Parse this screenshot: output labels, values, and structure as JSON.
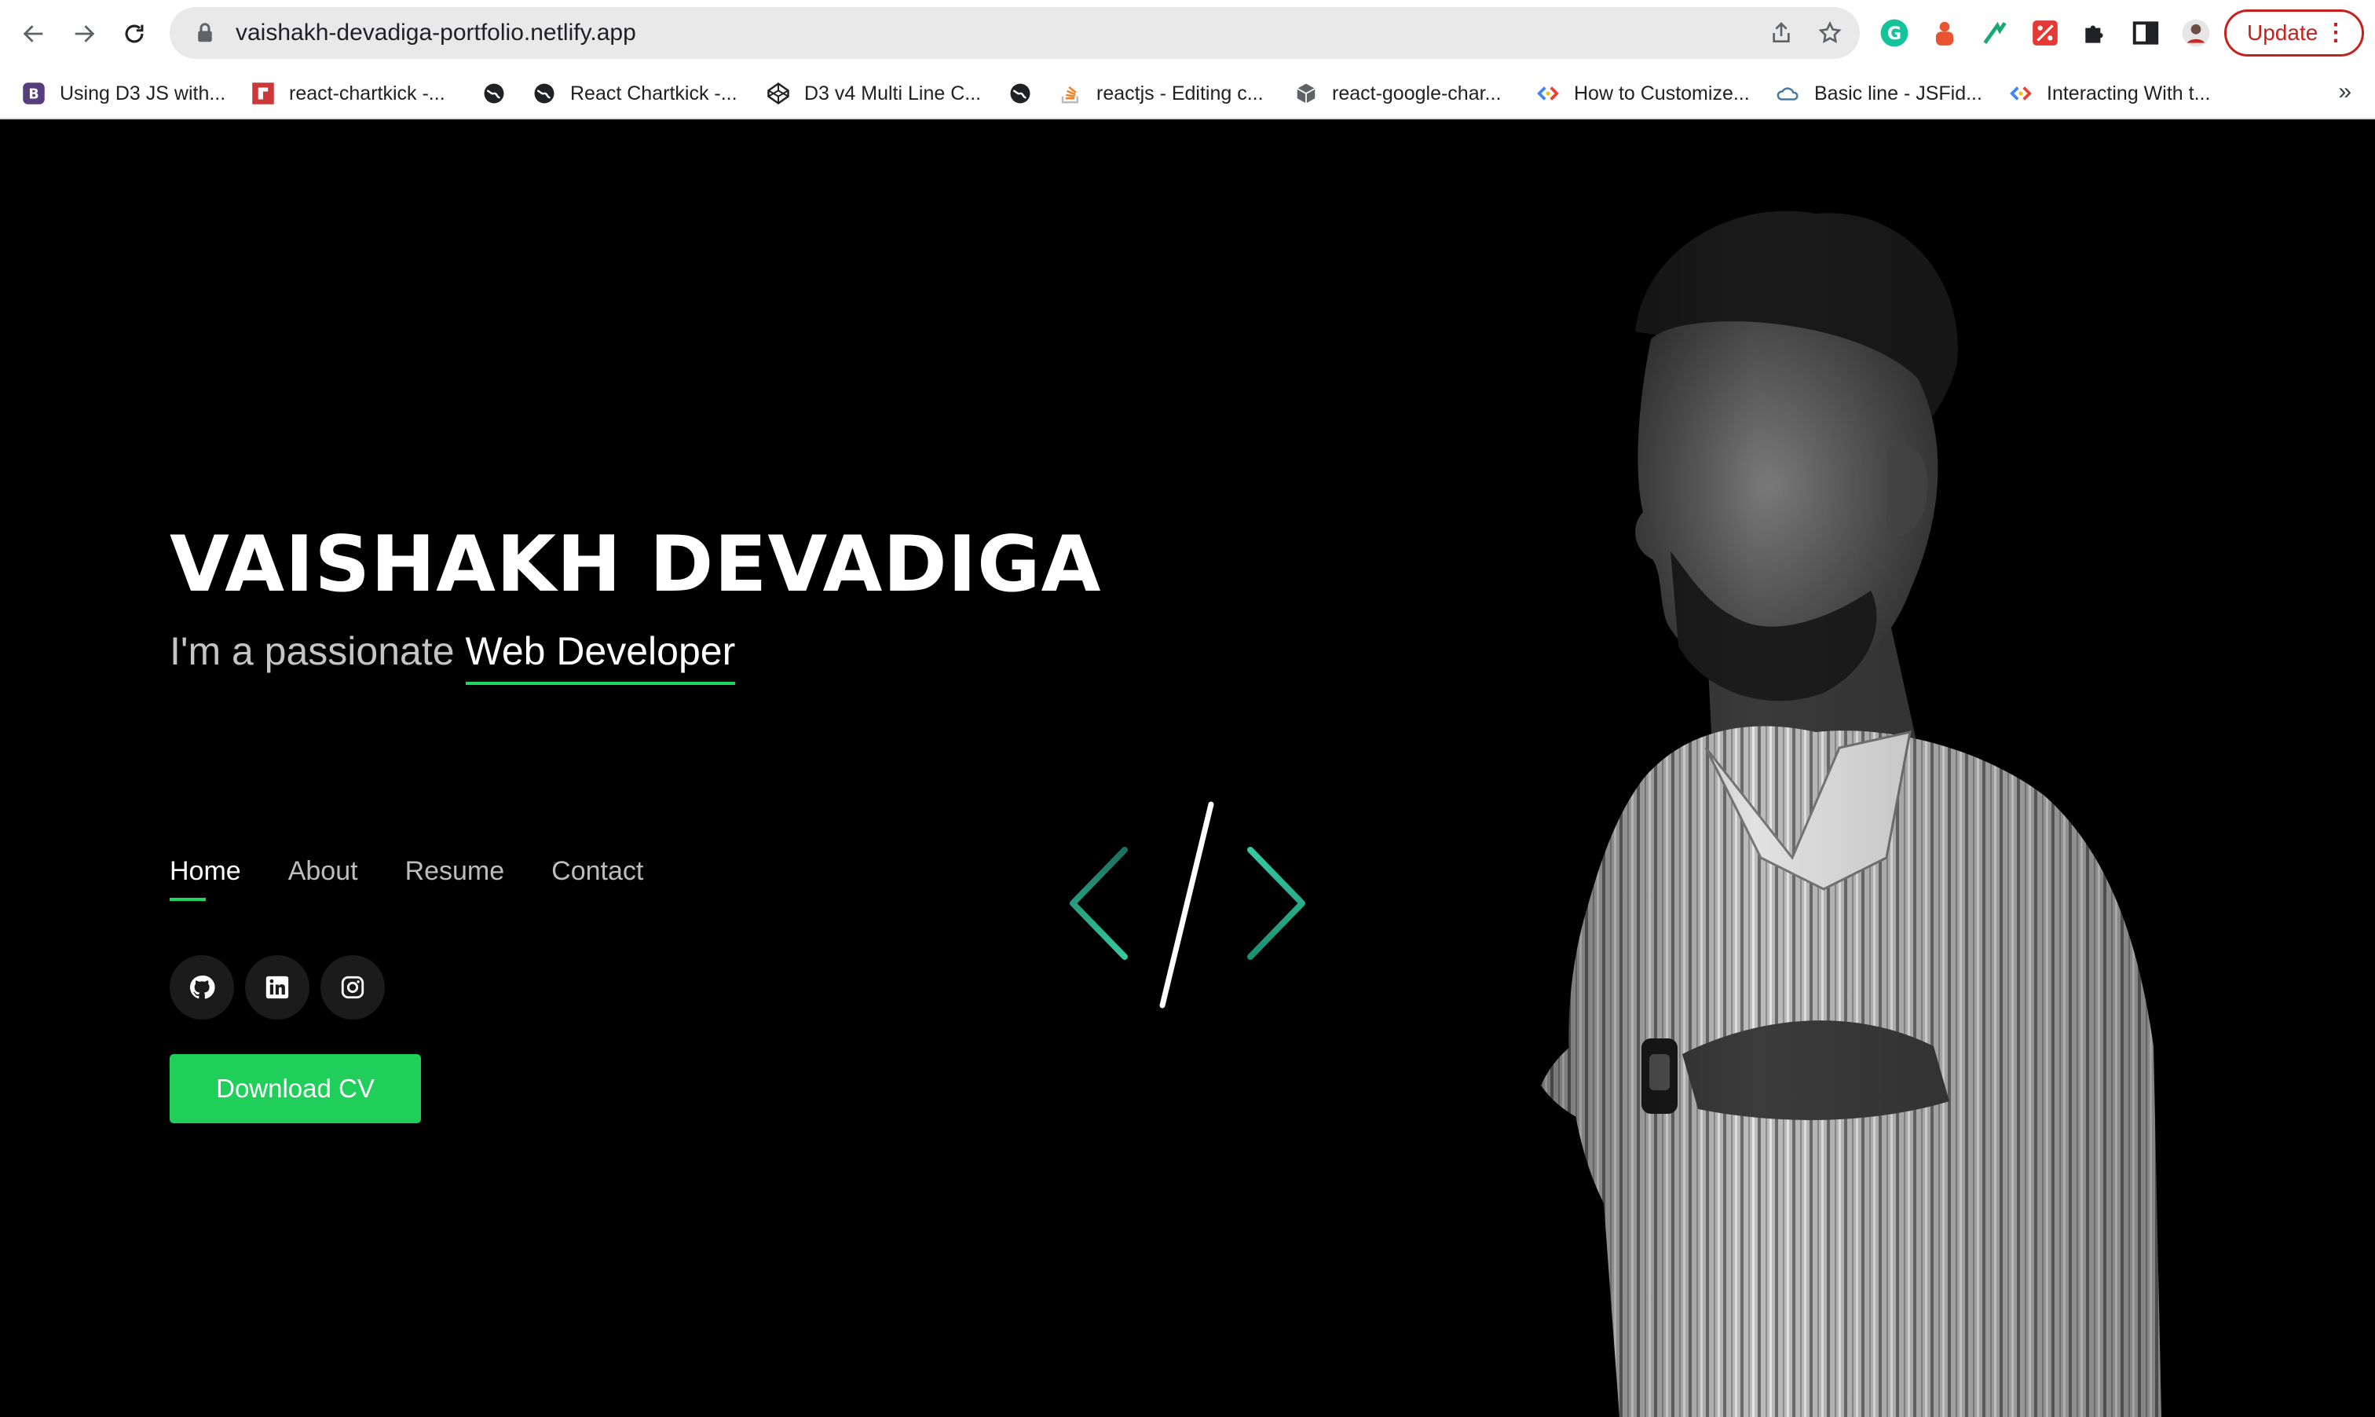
{
  "browser": {
    "url": "vaishakh-devadiga-portfolio.netlify.app",
    "update_label": "Update",
    "extensions": [
      "grammarly-icon",
      "bear-icon",
      "arrow-extension-icon",
      "percent-extension-icon",
      "puzzle-icon",
      "sidepanel-icon",
      "profile-avatar"
    ]
  },
  "bookmarks": [
    {
      "label": "Using D3 JS with...",
      "icon": "bootstrap-icon"
    },
    {
      "label": "react-chartkick -...",
      "icon": "npm-icon"
    },
    {
      "label": "",
      "icon": "globe-icon"
    },
    {
      "label": "React Chartkick -...",
      "icon": "globe-icon"
    },
    {
      "label": "D3 v4 Multi Line C...",
      "icon": "codepen-icon"
    },
    {
      "label": "",
      "icon": "globe-icon"
    },
    {
      "label": "reactjs - Editing c...",
      "icon": "stackoverflow-icon"
    },
    {
      "label": "react-google-char...",
      "icon": "package-icon"
    },
    {
      "label": "How to Customize...",
      "icon": "code-icon"
    },
    {
      "label": "Basic line - JSFid...",
      "icon": "jsfiddle-icon"
    },
    {
      "label": "Interacting With t...",
      "icon": "code-icon"
    }
  ],
  "hero": {
    "name": "VAISHAKH DEVADIGA",
    "tagline_prefix": "I'm a passionate",
    "tagline_role": "Web Developer",
    "accent_color": "#1ed760",
    "button_color": "#1fcf5a"
  },
  "nav": {
    "items": [
      "Home",
      "About",
      "Resume",
      "Contact"
    ],
    "active": "Home"
  },
  "socials": [
    "github-icon",
    "linkedin-icon",
    "instagram-icon"
  ],
  "cta": {
    "label": "Download CV"
  }
}
